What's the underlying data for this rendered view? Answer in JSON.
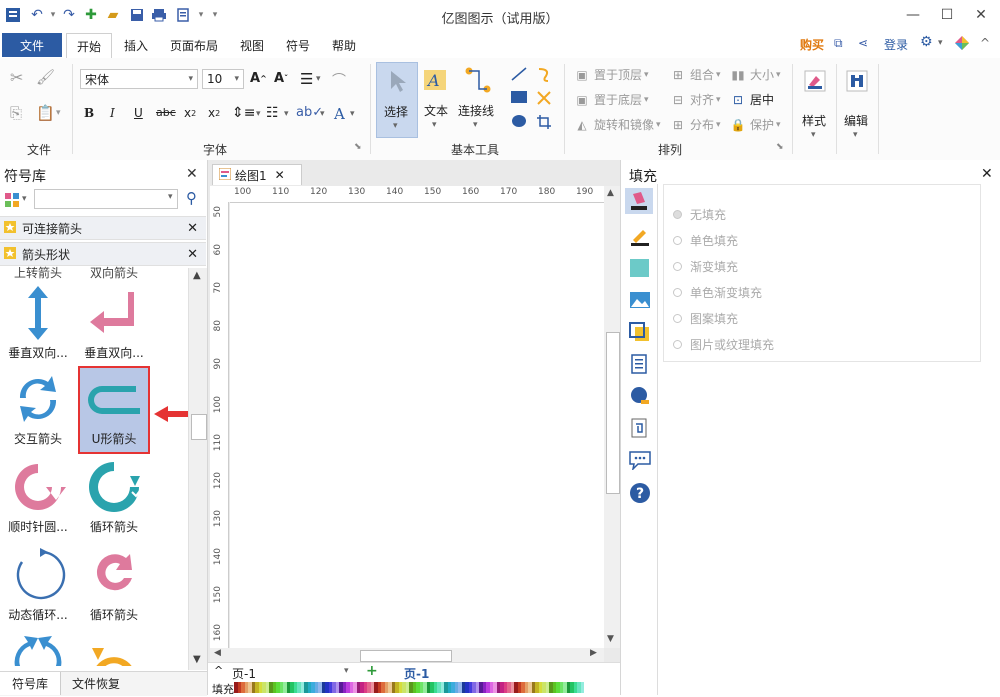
{
  "window": {
    "title": "亿图图示（试用版）"
  },
  "menu": {
    "file": "文件",
    "tabs": [
      "开始",
      "插入",
      "页面布局",
      "视图",
      "符号",
      "帮助"
    ],
    "buy": "购买",
    "login": "登录"
  },
  "ribbon": {
    "font_name": "宋体",
    "font_size": "10",
    "groups": {
      "file": "文件",
      "font": "字体",
      "tools": "基本工具",
      "arrange": "排列"
    },
    "tools": {
      "select": "选择",
      "text": "文本",
      "connector": "连接线"
    },
    "arrange": {
      "bring_front": "置于顶层",
      "send_back": "置于底层",
      "rotate": "旋转和镜像",
      "group": "组合",
      "align": "对齐",
      "distribute": "分布",
      "size": "大小",
      "center": "居中",
      "protect": "保护"
    },
    "style": "样式",
    "edit": "编辑"
  },
  "left_panel": {
    "title": "符号库",
    "search_value": "",
    "libraries": [
      "可连接箭头",
      "箭头形状"
    ],
    "shapes_partial_top": [
      "上转箭头",
      "双向箭头"
    ],
    "shapes": [
      {
        "label": "垂直双向..."
      },
      {
        "label": "垂直双向..."
      },
      {
        "label": "交互箭头"
      },
      {
        "label": "U形箭头"
      },
      {
        "label": "顺时针圆..."
      },
      {
        "label": "循环箭头"
      },
      {
        "label": "动态循环..."
      },
      {
        "label": "循环箭头"
      }
    ],
    "bottom_tabs": [
      "符号库",
      "文件恢复"
    ]
  },
  "canvas": {
    "doc_tab": "绘图1",
    "ruler_top": [
      "100",
      "110",
      "120",
      "130",
      "140",
      "150",
      "160",
      "170",
      "180",
      "190"
    ],
    "ruler_left": [
      "50",
      "60",
      "70",
      "80",
      "90",
      "100",
      "110",
      "120",
      "130",
      "140",
      "150",
      "160"
    ],
    "page_label": "页-1",
    "page_tab": "页-1",
    "fill_label": "填充"
  },
  "right_panel": {
    "title": "填充",
    "options": [
      "无填充",
      "单色填充",
      "渐变填充",
      "单色渐变填充",
      "图案填充",
      "图片或纹理填充"
    ]
  },
  "colors": {
    "accent": "#2c5ba3",
    "shape_blue": "#3a8fd0",
    "shape_pink": "#de7a9d",
    "shape_teal": "#2aa3ad",
    "shape_orange": "#f2a823",
    "highlight_red": "#e53333"
  }
}
